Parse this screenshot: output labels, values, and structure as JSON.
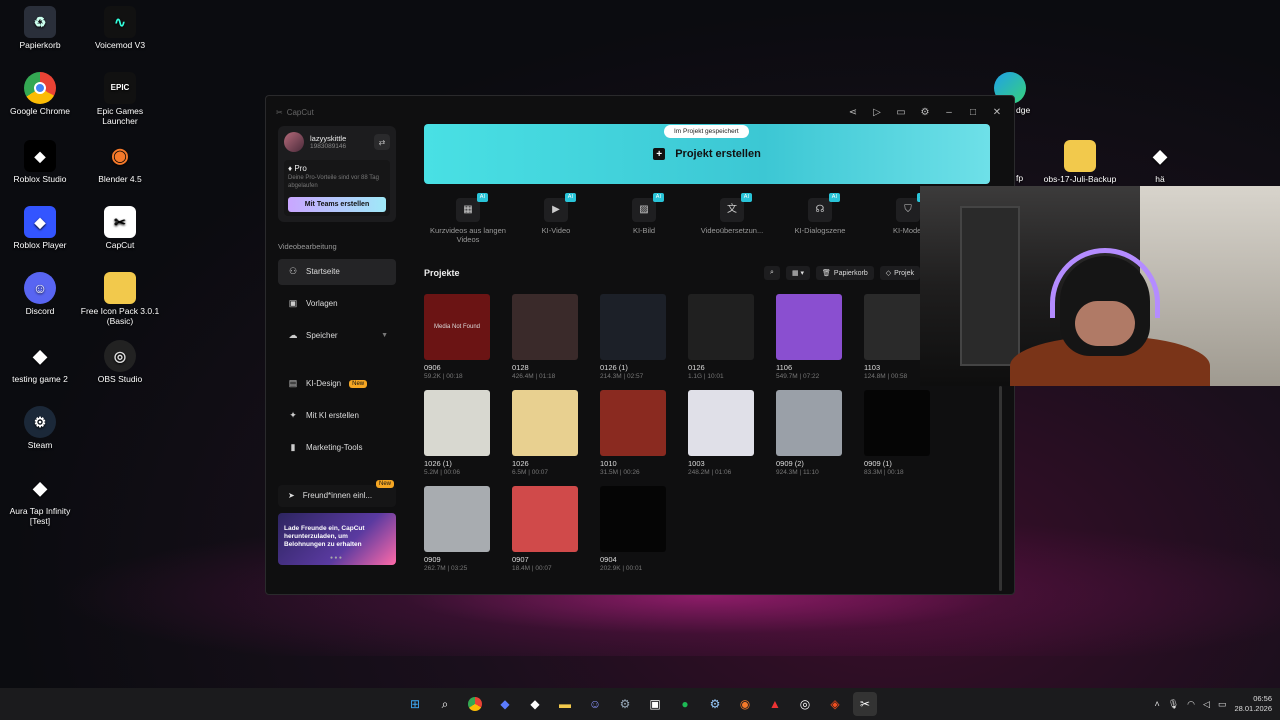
{
  "desktop": {
    "icons": [
      {
        "label": "Papierkorb",
        "icon": "recycle-bin-icon"
      },
      {
        "label": "Voicemod V3",
        "icon": "voicemod-icon"
      },
      {
        "label": "Google Chrome",
        "icon": "chrome-icon"
      },
      {
        "label": "Epic Games Launcher",
        "icon": "epic-games-icon"
      },
      {
        "label": "Roblox Studio",
        "icon": "roblox-studio-icon"
      },
      {
        "label": "Blender 4.5",
        "icon": "blender-icon"
      },
      {
        "label": "Roblox Player",
        "icon": "roblox-player-icon"
      },
      {
        "label": "CapCut",
        "icon": "capcut-icon"
      },
      {
        "label": "Discord",
        "icon": "discord-icon"
      },
      {
        "label": "Free Icon Pack 3.0.1 (Basic)",
        "icon": "folder-icon"
      },
      {
        "label": "testing game 2",
        "icon": "roblox-icon"
      },
      {
        "label": "OBS Studio",
        "icon": "obs-icon"
      },
      {
        "label": "Steam",
        "icon": "steam-icon"
      },
      {
        "label": "Aura Tap Infinity [Test]",
        "icon": "roblox-icon"
      },
      {
        "label": "fp",
        "icon": "file-icon"
      },
      {
        "label": "obs-17-Juli-Backup",
        "icon": "folder-icon"
      },
      {
        "label": "hä",
        "icon": "roblox-icon"
      },
      {
        "label": "dge",
        "icon": "edge-icon"
      }
    ]
  },
  "window": {
    "app_name": "CapCut",
    "controls": [
      "share-icon",
      "play-icon",
      "feedback-icon",
      "settings-icon",
      "minimize-icon",
      "maximize-icon",
      "close-icon"
    ]
  },
  "sidebar": {
    "account": {
      "name": "lazyyskittle",
      "id": "1983089146"
    },
    "pro": {
      "title": "Pro",
      "desc": "Deine Pro-Vorteile sind vor 88 Tag abgelaufen",
      "button": "Mit Teams erstellen"
    },
    "section_label": "Videobearbeitung",
    "nav": [
      {
        "label": "Startseite",
        "icon": "home-icon",
        "active": true
      },
      {
        "label": "Vorlagen",
        "icon": "templates-icon"
      },
      {
        "label": "Speicher",
        "icon": "cloud-icon"
      }
    ],
    "nav2": [
      {
        "label": "KI-Design",
        "icon": "design-icon",
        "badge": "New"
      },
      {
        "label": "Mit KI erstellen",
        "icon": "sparkle-icon"
      },
      {
        "label": "Marketing-Tools",
        "icon": "marketing-icon"
      }
    ],
    "invite": {
      "label": "Freund*innen einl...",
      "badge": "New"
    },
    "banner": {
      "text": "Lade Freunde ein, CapCut herunterzuladen, um Belohnungen zu erhalten"
    }
  },
  "main": {
    "create_label": "Projekt erstellen",
    "saved_tooltip": "Im Projekt gespeichert",
    "tools": [
      {
        "label": "Kurzvideos aus langen Videos",
        "badge": "AI"
      },
      {
        "label": "KI-Video",
        "badge": "AI"
      },
      {
        "label": "KI-Bild",
        "badge": "AI"
      },
      {
        "label": "Videoübersetzun...",
        "badge": "AI"
      },
      {
        "label": "KI-Dialogszene",
        "badge": "AI"
      },
      {
        "label": "KI-Model",
        "badge": "AI"
      }
    ],
    "projects_title": "Projekte",
    "project_tools": {
      "trash": "Papierkorb",
      "projects": "Projek"
    },
    "projects": [
      {
        "name": "0906",
        "meta": "59.2K | 00:18",
        "thumb": "#6b1414",
        "text": "Media Not Found"
      },
      {
        "name": "0128",
        "meta": "426.4M | 01:18",
        "thumb": "#3a2a2a",
        "text": ""
      },
      {
        "name": "0126 (1)",
        "meta": "214.3M | 02:57",
        "thumb": "#1c2028",
        "text": ""
      },
      {
        "name": "0126",
        "meta": "1.1G | 10:01",
        "thumb": "#202020",
        "text": ""
      },
      {
        "name": "1106",
        "meta": "549.7M | 07:22",
        "thumb": "#8a4fd0",
        "text": ""
      },
      {
        "name": "1103",
        "meta": "124.8M | 00:58",
        "thumb": "#2a2a2a",
        "text": ""
      },
      {
        "name": "1026 (1)",
        "meta": "5.2M | 00:06",
        "thumb": "#d8d8d0",
        "text": ""
      },
      {
        "name": "1026",
        "meta": "6.5M | 00:07",
        "thumb": "#e8d090",
        "text": ""
      },
      {
        "name": "1010",
        "meta": "31.5M | 00:26",
        "thumb": "#8a2a20",
        "text": ""
      },
      {
        "name": "1003",
        "meta": "248.2M | 01:06",
        "thumb": "#e0e0e8",
        "text": ""
      },
      {
        "name": "0909 (2)",
        "meta": "924.3M | 11:10",
        "thumb": "#9aa0a8",
        "text": ""
      },
      {
        "name": "0909 (1)",
        "meta": "83.3M | 00:18",
        "thumb": "#050505",
        "text": ""
      },
      {
        "name": "0909",
        "meta": "262.7M | 03:25",
        "thumb": "#a8acb0",
        "text": ""
      },
      {
        "name": "0907",
        "meta": "18.4M | 00:07",
        "thumb": "#d04a4a",
        "text": ""
      },
      {
        "name": "0904",
        "meta": "202.9K | 00:01",
        "thumb": "#050505",
        "text": ""
      }
    ]
  },
  "taskbar": {
    "apps": [
      "windows-start-icon",
      "search-icon",
      "chrome-icon",
      "roblox-studio-icon",
      "roblox-icon",
      "folder-icon",
      "discord-icon",
      "settings-icon",
      "store-icon",
      "spotify-icon",
      "steam-icon",
      "blender-icon",
      "acrobat-icon",
      "obs-icon",
      "figma-icon",
      "capcut-icon"
    ],
    "time": "06:56",
    "date": "28.01.2026"
  }
}
